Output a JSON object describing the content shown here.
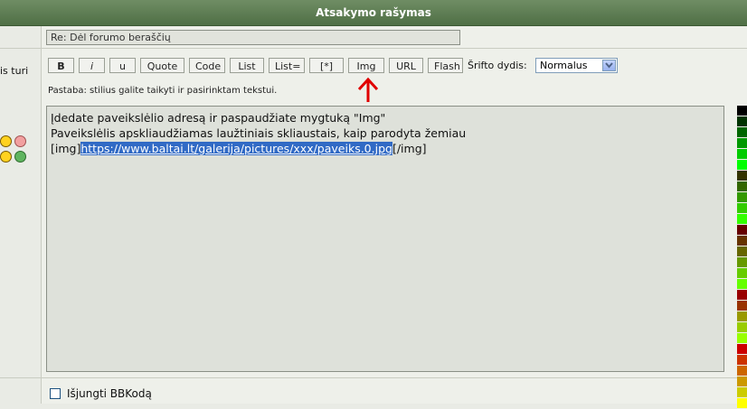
{
  "header": {
    "title": "Atsakymo rašymas"
  },
  "subject": {
    "value": "Re: Dėl forumo beraščių"
  },
  "side": {
    "text": "is turi",
    "smilies": [
      "grin-smiley-icon",
      "sad-smiley-icon",
      "neutral-smiley-icon",
      "green-smiley-icon"
    ]
  },
  "toolbar": {
    "buttons": [
      "B",
      "i",
      "u",
      "Quote",
      "Code",
      "List",
      "List=",
      "[*]",
      "Img",
      "URL",
      "Flash"
    ],
    "font_size_label": "Šrifto dydis:",
    "font_size_value": "Normalus"
  },
  "hint": "Pastaba: stilius galite taikyti ir pasirinktam tekstui.",
  "editor": {
    "line1": "Įdedate paveikslėlio adresą ir paspaudžiate mygtuką \"Img\"",
    "line2": "Paveikslėlis apskliaudžiamas laužtiniais skliaustais, kaip parodyta žemiau",
    "line3_prefix": "[img]",
    "line3_selected": "https://www.baltai.lt/galerija/pictures/xxx/paveiks.0.jpg",
    "line3_suffix": "[/img]"
  },
  "palette_colors": [
    "#000000",
    "#003300",
    "#006600",
    "#009900",
    "#00cc00",
    "#00ff00",
    "#333300",
    "#336600",
    "#339900",
    "#33cc00",
    "#33ff00",
    "#660000",
    "#663300",
    "#666600",
    "#669900",
    "#66cc00",
    "#66ff00",
    "#990000",
    "#993300",
    "#999900",
    "#99cc00",
    "#99ff00",
    "#cc0000",
    "#cc3300",
    "#cc6600",
    "#cc9900",
    "#cccc00",
    "#ffff00"
  ],
  "annotation": {
    "arrow_color": "#e00000"
  },
  "disable_bbcode": {
    "label": "Išjungti BBKodą"
  }
}
